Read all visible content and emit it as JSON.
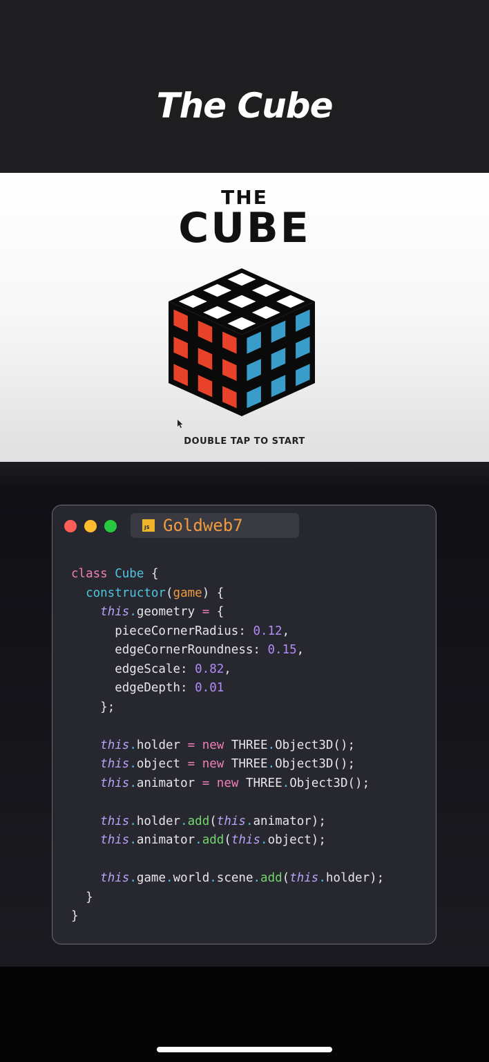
{
  "header": {
    "title": "The Cube"
  },
  "preview": {
    "logo_line1": "THE",
    "logo_line2": "CUBE",
    "start_prompt": "DOUBLE TAP TO START",
    "cube_colors": {
      "top": "#ffffff",
      "left": "#e8432a",
      "right": "#3a9cc8",
      "border": "#0a0a0a"
    }
  },
  "code_window": {
    "file_badge": "JS",
    "file_name": "Goldweb7",
    "window_controls": [
      "close-dot",
      "minimize-dot",
      "maximize-dot"
    ],
    "code_lines": [
      "class Cube {",
      "  constructor(game) {",
      "    this.geometry = {",
      "      pieceCornerRadius: 0.12,",
      "      edgeCornerRoundness: 0.15,",
      "      edgeScale: 0.82,",
      "      edgeDepth: 0.01",
      "    };",
      "",
      "    this.holder = new THREE.Object3D();",
      "    this.object = new THREE.Object3D();",
      "    this.animator = new THREE.Object3D();",
      "",
      "    this.holder.add(this.animator);",
      "    this.animator.add(this.object);",
      "",
      "    this.game.world.scene.add(this.holder);",
      "  }",
      "}"
    ]
  }
}
